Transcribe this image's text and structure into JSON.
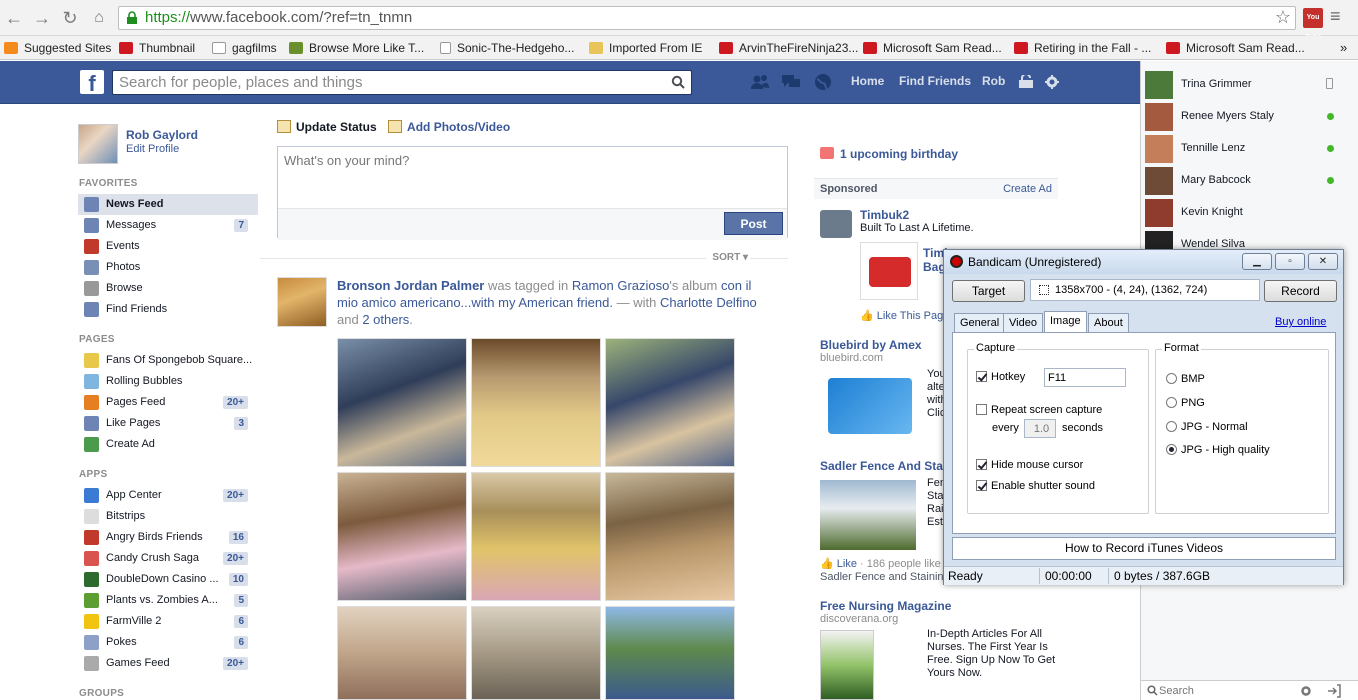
{
  "browser": {
    "url_scheme": "https://",
    "url_rest": "www.facebook.com/?ref=tn_tnmn",
    "youtube_ext": "You Tube",
    "bookmarks": [
      {
        "label": "Suggested Sites",
        "icon": "sug"
      },
      {
        "label": "Thumbnail",
        "icon": "yt"
      },
      {
        "label": "gagfilms",
        "icon": "gag"
      },
      {
        "label": "Browse More Like T...",
        "icon": "grn"
      },
      {
        "label": "Sonic-The-Hedgeho...",
        "icon": "page"
      },
      {
        "label": "Imported From IE",
        "icon": "folder"
      },
      {
        "label": "ArvinTheFireNinja23...",
        "icon": "yt"
      },
      {
        "label": "Microsoft Sam Read...",
        "icon": "yt"
      },
      {
        "label": "Retiring in the Fall - ...",
        "icon": "yt"
      },
      {
        "label": "Microsoft Sam Read...",
        "icon": "yt"
      }
    ],
    "more_bookmarks": "»"
  },
  "header": {
    "logo": "f",
    "search_placeholder": "Search for people, places and things",
    "links": {
      "home": "Home",
      "find_friends": "Find Friends",
      "profile": "Rob"
    }
  },
  "left": {
    "profile": {
      "name": "Rob Gaylord",
      "edit": "Edit Profile"
    },
    "favorites_title": "FAVORITES",
    "favorites": [
      {
        "label": "News Feed",
        "count": "",
        "color": "#6d84b4"
      },
      {
        "label": "Messages",
        "count": "7",
        "color": "#6d84b4"
      },
      {
        "label": "Events",
        "count": "",
        "color": "#c0392b"
      },
      {
        "label": "Photos",
        "count": "",
        "color": "#7a8fb5"
      },
      {
        "label": "Browse",
        "count": "",
        "color": "#999999"
      },
      {
        "label": "Find Friends",
        "count": "",
        "color": "#6d84b4"
      }
    ],
    "pages_title": "PAGES",
    "pages": [
      {
        "label": "Fans Of Spongebob Square...",
        "count": "",
        "color": "#e8c84a"
      },
      {
        "label": "Rolling Bubbles",
        "count": "",
        "color": "#7fb6e0"
      },
      {
        "label": "Pages Feed",
        "count": "20+",
        "color": "#e67e22"
      },
      {
        "label": "Like Pages",
        "count": "3",
        "color": "#6d84b4"
      },
      {
        "label": "Create Ad",
        "count": "",
        "color": "#4c9a4c"
      }
    ],
    "apps_title": "APPS",
    "apps": [
      {
        "label": "App Center",
        "count": "20+",
        "color": "#3b7bd4"
      },
      {
        "label": "Bitstrips",
        "count": "",
        "color": "#dddddd"
      },
      {
        "label": "Angry Birds Friends",
        "count": "16",
        "color": "#c0392b"
      },
      {
        "label": "Candy Crush Saga",
        "count": "20+",
        "color": "#d9534f"
      },
      {
        "label": "DoubleDown Casino ...",
        "count": "10",
        "color": "#2d6a2d"
      },
      {
        "label": "Plants vs. Zombies A...",
        "count": "5",
        "color": "#5c9e31"
      },
      {
        "label": "FarmVille 2",
        "count": "6",
        "color": "#f1c40f"
      },
      {
        "label": "Pokes",
        "count": "6",
        "color": "#8da0c8"
      },
      {
        "label": "Games Feed",
        "count": "20+",
        "color": "#aaaaaa"
      }
    ],
    "groups_title": "GROUPS"
  },
  "composer": {
    "tab_status": "Update Status",
    "tab_photos": "Add Photos/Video",
    "placeholder": "What's on your mind?",
    "post": "Post",
    "sort": "SORT ▾"
  },
  "story": {
    "actor": "Bronson Jordan Palmer",
    "t1": " was tagged in ",
    "owner": "Ramon Grazioso",
    "t2": "'s album ",
    "album": "con il mio amico americano...with my American friend.",
    "t3": " — with ",
    "with1": "Charlotte Delfino",
    "t4": " and ",
    "others": "2 others",
    "t5": "."
  },
  "right": {
    "birthday": "1 upcoming birthday",
    "sponsored": "Sponsored",
    "create_ad": "Create Ad",
    "ads": [
      {
        "title": "Timbuk2",
        "body": "Built To Last A Lifetime."
      },
      {
        "title": "Timb",
        "sub": "Bags"
      },
      {
        "like": "Like This Page"
      },
      {
        "title": "Bluebird by Amex",
        "url": "bluebird.com",
        "body": "You\nalte\nwith\nClic"
      },
      {
        "title": "Sadler Fence And Stai",
        "body": "Fen\nSta\nRail\nEst",
        "like": "Like",
        "likes": " · 186 people like",
        "footer": "Sadler Fence and Staining"
      },
      {
        "title": "Free Nursing Magazine",
        "url": "discoverana.org",
        "body": "In-Depth Articles For All Nurses. The First Year Is Free. Sign Up Now To Get Yours Now."
      }
    ]
  },
  "chat": {
    "friends": [
      {
        "name": "Trina Grimmer",
        "status": "mobile"
      },
      {
        "name": "Renee Myers Staly",
        "status": "online"
      },
      {
        "name": "Tennille Lenz",
        "status": "online"
      },
      {
        "name": "Mary Babcock",
        "status": "online"
      },
      {
        "name": "Kevin Knight",
        "status": "none"
      },
      {
        "name": "Wendel Silva",
        "status": "none"
      }
    ],
    "search_placeholder": "Search"
  },
  "bandicam": {
    "title": "Bandicam (Unregistered)",
    "target": "Target",
    "area": "1358x700 - (4, 24), (1362, 724)",
    "record": "Record",
    "tabs": [
      "General",
      "Video",
      "Image",
      "About"
    ],
    "active_tab": "Image",
    "buy": "Buy online",
    "capture_title": "Capture",
    "hotkey_label": "Hotkey",
    "hotkey_value": "F11",
    "repeat_label": "Repeat screen capture",
    "every_label": "every",
    "every_value": "1.0",
    "seconds_label": "seconds",
    "hide_cursor": "Hide mouse cursor",
    "shutter": "Enable shutter sound",
    "format_title": "Format",
    "formats": [
      "BMP",
      "PNG",
      "JPG - Normal",
      "JPG - High quality"
    ],
    "selected_format": "JPG - High quality",
    "howto": "How to Record iTunes Videos",
    "status_ready": "Ready",
    "status_time": "00:00:00",
    "status_size": "0 bytes / 387.6GB"
  }
}
